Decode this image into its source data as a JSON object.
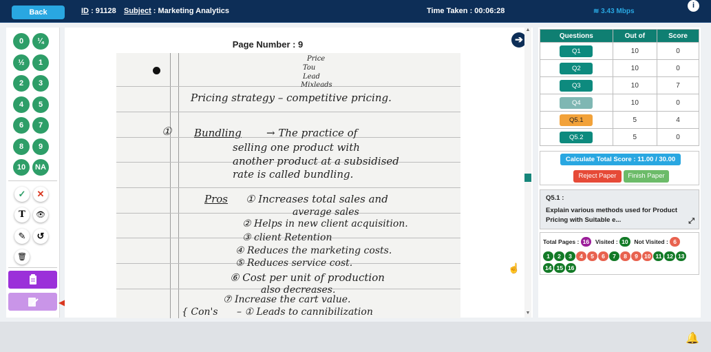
{
  "header": {
    "back_label": "Back",
    "id_label": "ID",
    "id_value": ": 91128",
    "subject_label": "Subject",
    "subject_value": ": Marketing Analytics",
    "time_taken": "Time Taken : 00:06:28",
    "speed": "3.43 Mbps",
    "info": "i"
  },
  "marks": [
    "0",
    "¼",
    "½",
    "1",
    "2",
    "3",
    "4",
    "5",
    "6",
    "7",
    "8",
    "9",
    "10",
    "NA"
  ],
  "tools": {
    "check": "✓",
    "cross": "✕",
    "text": "T",
    "eye": "👁",
    "pen": "✎",
    "undo": "↺",
    "trash": "🗑"
  },
  "viewer": {
    "page_number": "Page Number : 9",
    "next": "➔"
  },
  "handwriting": [
    "Price",
    "Tou",
    "Lead",
    "Mixleads",
    "Pricing strategy – competitive pricing.",
    "①",
    "Bundling",
    "→ The practice of",
    "selling one product with",
    "another product at a subsidised",
    "rate is called bundling.",
    "Pros",
    "① Increases total sales and",
    "average sales",
    "② Helps in new client acquisition.",
    "③ client Retention",
    "④ Reduces the marketing costs.",
    "⑤ Reduces service cost.",
    "⑥ Cost per unit of production",
    "also decreases.",
    "⑦ Increase the cart value.",
    "{ Con's",
    "– ① Leads to cannibilization"
  ],
  "scores_table": {
    "headers": [
      "Questions",
      "Out of",
      "Score"
    ],
    "rows": [
      {
        "q": "Q1",
        "out_of": "10",
        "score": "0",
        "state": "normal"
      },
      {
        "q": "Q2",
        "out_of": "10",
        "score": "0",
        "state": "normal"
      },
      {
        "q": "Q3",
        "out_of": "10",
        "score": "7",
        "state": "normal"
      },
      {
        "q": "Q4",
        "out_of": "10",
        "score": "0",
        "state": "disabled"
      },
      {
        "q": "Q5.1",
        "out_of": "5",
        "score": "4",
        "state": "active"
      },
      {
        "q": "Q5.2",
        "out_of": "5",
        "score": "0",
        "state": "normal"
      }
    ]
  },
  "actions": {
    "calculate": "Calculate Total Score : 11.00 / 30.00",
    "reject": "Reject Paper",
    "finish": "Finish Paper"
  },
  "question": {
    "id": "Q5.1 :",
    "text": "Explain various methods used for Product Pricing with Suitable e..."
  },
  "pages": {
    "total_label": "Total Pages :",
    "total": "16",
    "visited_label": "Visited :",
    "visited": "10",
    "not_visited_label": "Not Visited :",
    "not_visited": "6",
    "list": [
      {
        "n": "1",
        "v": true
      },
      {
        "n": "2",
        "v": true
      },
      {
        "n": "3",
        "v": true
      },
      {
        "n": "4",
        "v": false
      },
      {
        "n": "5",
        "v": false
      },
      {
        "n": "6",
        "v": false
      },
      {
        "n": "7",
        "v": true
      },
      {
        "n": "8",
        "v": false
      },
      {
        "n": "9",
        "v": false
      },
      {
        "n": "10",
        "v": false
      },
      {
        "n": "11",
        "v": true
      },
      {
        "n": "12",
        "v": true
      },
      {
        "n": "13",
        "v": true
      },
      {
        "n": "14",
        "v": true
      },
      {
        "n": "15",
        "v": true
      },
      {
        "n": "16",
        "v": true
      }
    ]
  },
  "footer": {
    "bell": "🔔"
  },
  "colors": {
    "header_bg": "#0d2e57",
    "accent_blue": "#29a7e1",
    "mark_green": "#2e9e68",
    "teal": "#0f7f72",
    "visited_green": "#137a27",
    "not_visited_red": "#e8624f",
    "purple": "#9b30d9"
  }
}
